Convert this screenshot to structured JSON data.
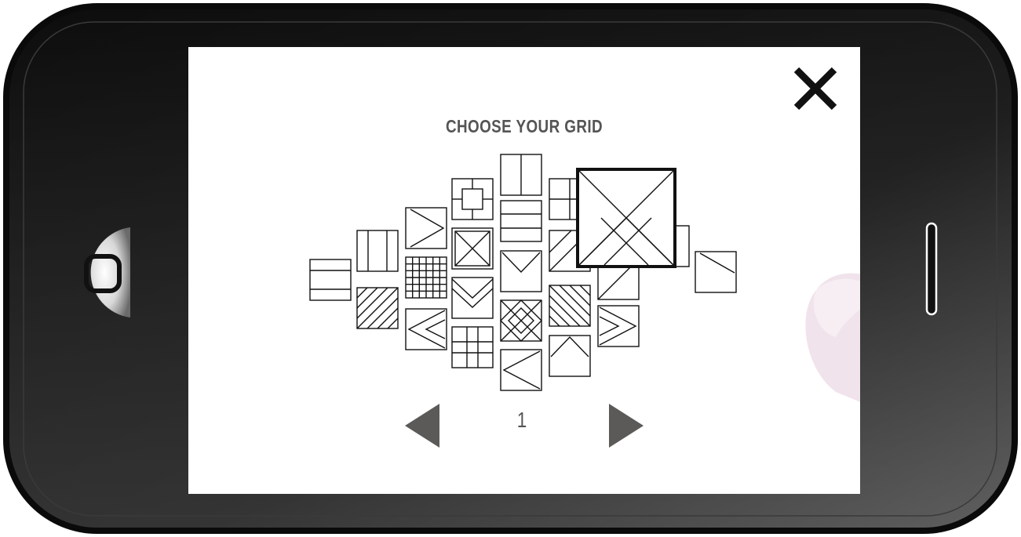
{
  "screen": {
    "title": "CHOOSE YOUR GRID",
    "close_icon": "close-icon",
    "page_number": "1",
    "prev_icon": "left-triangle-icon",
    "next_icon": "right-triangle-icon"
  },
  "grid_options": [
    "horizontal-split",
    "vertical-thirds",
    "diagonal-lines",
    "arrow-right",
    "fine-grid",
    "chevron-left",
    "nested-squares",
    "x-cross",
    "v-shape",
    "plus-grid",
    "vertical-half",
    "horizontal-thirds",
    "triangle-down",
    "diamond-x",
    "chevron-left-large",
    "quad-grid",
    "diagonal-half",
    "diagonal-lines-reverse",
    "chevrons-right",
    "triangle-up",
    "diagonal-crosshatch-selected"
  ],
  "hardware": {
    "home_button_icon": "rounded-square-icon"
  },
  "colors": {
    "bezel": "#1a1a1a",
    "title_text": "#555555",
    "arrow_fill": "#5b5a58",
    "finger_tint": "#f0e4ec"
  }
}
